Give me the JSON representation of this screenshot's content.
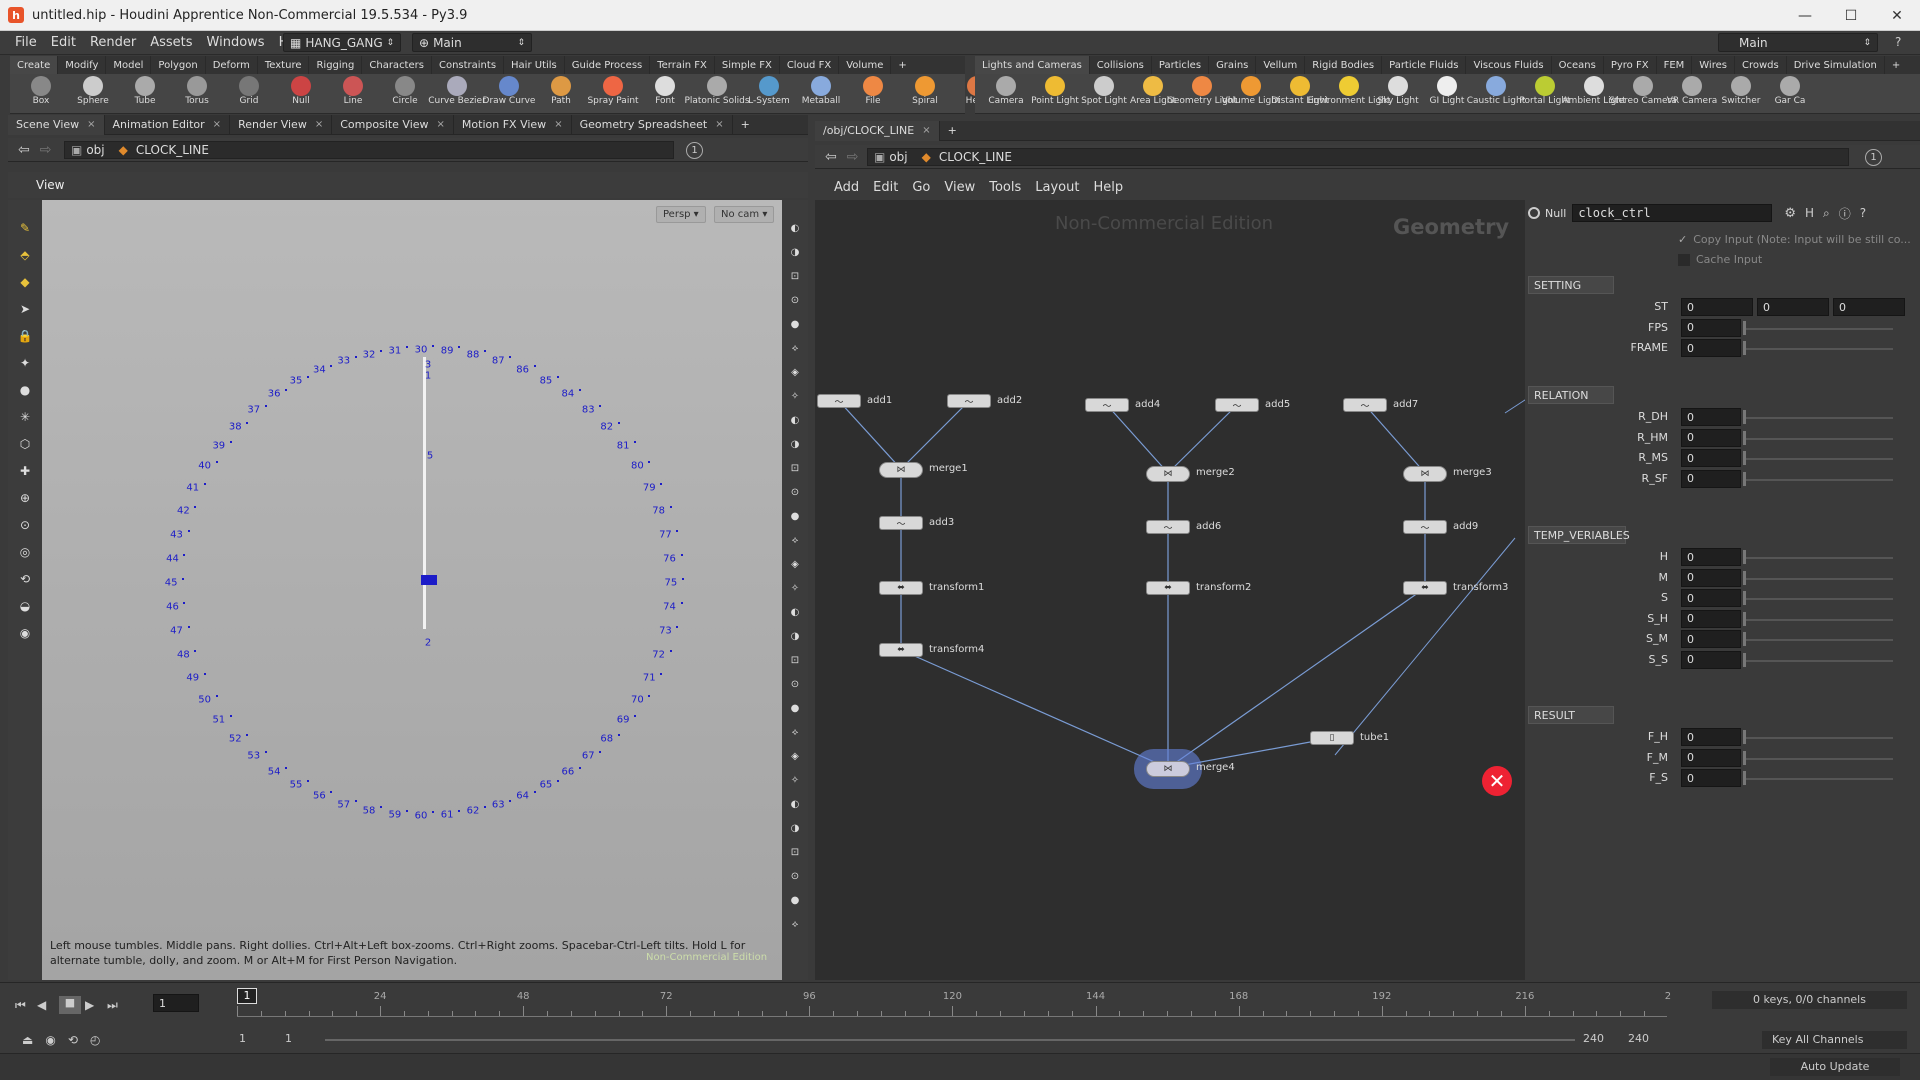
{
  "window": {
    "title": "untitled.hip - Houdini Apprentice Non-Commercial 19.5.534 - Py3.9"
  },
  "menubar": {
    "items": [
      "File",
      "Edit",
      "Render",
      "Assets",
      "Windows",
      "Help"
    ],
    "desktop": "HANG_GANG",
    "network": "Main",
    "right_desktop": "Main"
  },
  "shelf_left": {
    "tabs": [
      "Create",
      "Modify",
      "Model",
      "Polygon",
      "Deform",
      "Texture",
      "Rigging",
      "Characters",
      "Constraints",
      "Hair Utils",
      "Guide Process",
      "Terrain FX",
      "Simple FX",
      "Cloud FX",
      "Volume"
    ],
    "tools": [
      "Box",
      "Sphere",
      "Tube",
      "Torus",
      "Grid",
      "Null",
      "Line",
      "Circle",
      "Curve Bezier",
      "Draw Curve",
      "Path",
      "Spray Paint",
      "Font",
      "Platonic Solids",
      "L-System",
      "Metaball",
      "File",
      "Spiral",
      "Helix"
    ]
  },
  "shelf_right": {
    "tabs": [
      "Lights and Cameras",
      "Collisions",
      "Particles",
      "Grains",
      "Vellum",
      "Rigid Bodies",
      "Particle Fluids",
      "Viscous Fluids",
      "Oceans",
      "Pyro FX",
      "FEM",
      "Wires",
      "Crowds",
      "Drive Simulation"
    ],
    "tools": [
      "Camera",
      "Point Light",
      "Spot Light",
      "Area Light",
      "Geometry Light",
      "Volume Light",
      "Distant Light",
      "Environment Light",
      "Sky Light",
      "GI Light",
      "Caustic Light",
      "Portal Light",
      "Ambient Light",
      "Stereo Camera",
      "VR Camera",
      "Switcher",
      "Gar Ca"
    ]
  },
  "left_pane": {
    "tabs": [
      "Scene View",
      "Animation Editor",
      "Render View",
      "Composite View",
      "Motion FX View",
      "Geometry Spreadsheet"
    ],
    "path_root": "obj",
    "path_node": "CLOCK_LINE",
    "view_label": "View",
    "persp": "Persp",
    "cam": "No cam",
    "hint": "Left mouse tumbles. Middle pans. Right dollies. Ctrl+Alt+Left box-zooms. Ctrl+Right zooms. Spacebar-Ctrl-Left tilts. Hold L for alternate tumble, dolly, and zoom.    M or Alt+M for First Person Navigation.",
    "watermark": "Non-Commercial Edition",
    "hand_labels": [
      "3",
      "1",
      "5",
      "2"
    ]
  },
  "clock": {
    "numbers": [
      "30",
      "31",
      "32",
      "33",
      "34",
      "35",
      "36",
      "37",
      "38",
      "39",
      "40",
      "41",
      "42",
      "43",
      "44",
      "45",
      "46",
      "47",
      "48",
      "49",
      "50",
      "51",
      "52",
      "53",
      "54",
      "55",
      "56",
      "57",
      "58",
      "59",
      "60",
      "61",
      "62",
      "63",
      "64",
      "65",
      "66",
      "67",
      "68",
      "69",
      "70",
      "71",
      "72",
      "73",
      "74",
      "75",
      "76",
      "77",
      "78",
      "79",
      "80",
      "81",
      "82",
      "83",
      "84",
      "85",
      "86",
      "87",
      "88",
      "89"
    ]
  },
  "right_pane": {
    "tab": "/obj/CLOCK_LINE",
    "path_root": "obj",
    "path_node": "CLOCK_LINE",
    "menus": [
      "Add",
      "Edit",
      "Go",
      "View",
      "Tools",
      "Layout",
      "Help"
    ],
    "watermark": "Non-Commercial Edition",
    "context": "Geometry"
  },
  "nodes": [
    {
      "label": "add1"
    },
    {
      "label": "add2"
    },
    {
      "label": "merge1"
    },
    {
      "label": "add3"
    },
    {
      "label": "transform1"
    },
    {
      "label": "transform4"
    },
    {
      "label": "add4"
    },
    {
      "label": "add5"
    },
    {
      "label": "merge2"
    },
    {
      "label": "add6"
    },
    {
      "label": "transform2"
    },
    {
      "label": "add7"
    },
    {
      "label": "merge3"
    },
    {
      "label": "add9"
    },
    {
      "label": "transform3"
    },
    {
      "label": "tube1"
    },
    {
      "label": "merge4"
    }
  ],
  "params": {
    "type": "Null",
    "name": "clock_ctrl",
    "copy_input": "Copy Input (Note: Input will be still co...",
    "cache_input": "Cache Input",
    "sections": [
      {
        "title": "SETTING",
        "rows": [
          {
            "label": "ST",
            "values": [
              "0",
              "0",
              "0"
            ]
          },
          {
            "label": "FPS",
            "values": [
              "0"
            ]
          },
          {
            "label": "FRAME",
            "values": [
              "0"
            ]
          }
        ]
      },
      {
        "title": "RELATION",
        "rows": [
          {
            "label": "R_DH",
            "values": [
              "0"
            ]
          },
          {
            "label": "R_HM",
            "values": [
              "0"
            ]
          },
          {
            "label": "R_MS",
            "values": [
              "0"
            ]
          },
          {
            "label": "R_SF",
            "values": [
              "0"
            ]
          }
        ]
      },
      {
        "title": "TEMP_VERIABLES",
        "rows": [
          {
            "label": "H",
            "values": [
              "0"
            ]
          },
          {
            "label": "M",
            "values": [
              "0"
            ]
          },
          {
            "label": "S",
            "values": [
              "0"
            ]
          },
          {
            "label": "S_H",
            "values": [
              "0"
            ]
          },
          {
            "label": "S_M",
            "values": [
              "0"
            ]
          },
          {
            "label": "S_S",
            "values": [
              "0"
            ]
          }
        ]
      },
      {
        "title": "RESULT",
        "rows": [
          {
            "label": "F_H",
            "values": [
              "0"
            ]
          },
          {
            "label": "F_M",
            "values": [
              "0"
            ]
          },
          {
            "label": "F_S",
            "values": [
              "0"
            ]
          }
        ]
      }
    ]
  },
  "timeline": {
    "frame": "1",
    "ticks": [
      "24",
      "48",
      "72",
      "96",
      "120",
      "144",
      "168",
      "192",
      "216",
      "2"
    ],
    "current": "1",
    "range_start": "1",
    "range_start2": "1",
    "range_end": "240",
    "range_end2": "240",
    "keys": "0 keys, 0/0 channels",
    "key_all": "Key All Channels",
    "auto_update": "Auto Update"
  }
}
